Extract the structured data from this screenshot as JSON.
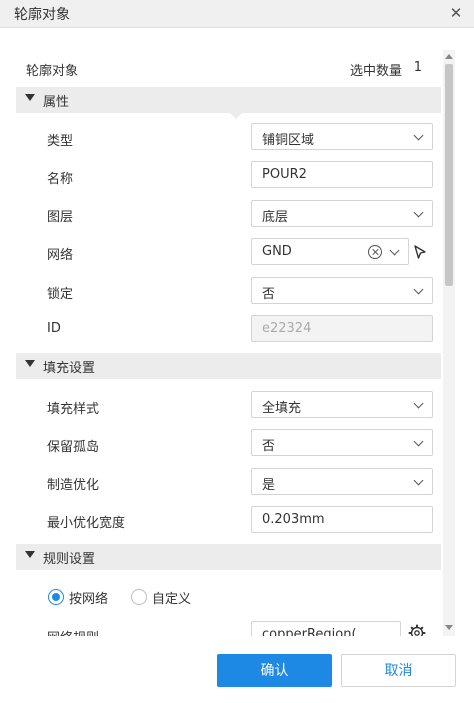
{
  "window": {
    "title": "轮廓对象"
  },
  "summary": {
    "label": "轮廓对象",
    "count_label": "选中数量",
    "count": "1"
  },
  "sections": {
    "properties": {
      "title": "属性",
      "rows": {
        "type": {
          "label": "类型",
          "value": "铺铜区域"
        },
        "name": {
          "label": "名称",
          "value": "POUR2"
        },
        "layer": {
          "label": "图层",
          "value": "底层"
        },
        "net": {
          "label": "网络",
          "value": "GND"
        },
        "lock": {
          "label": "锁定",
          "value": "否"
        },
        "id": {
          "label": "ID",
          "value": "e22324"
        }
      }
    },
    "fill": {
      "title": "填充设置",
      "rows": {
        "fill_style": {
          "label": "填充样式",
          "value": "全填充"
        },
        "keep_islands": {
          "label": "保留孤岛",
          "value": "否"
        },
        "optimize": {
          "label": "制造优化",
          "value": "是"
        },
        "min_width": {
          "label": "最小优化宽度",
          "value": "0.203mm"
        }
      }
    },
    "rules": {
      "title": "规则设置",
      "radio_by_net": "按网络",
      "radio_custom": "自定义",
      "selected": "按网络",
      "net_rule": {
        "label": "网络规则",
        "value": "copperRegion("
      }
    }
  },
  "buttons": {
    "confirm": "确认",
    "cancel": "取消"
  },
  "colors": {
    "accent": "#1e88e5",
    "section_bg": "#ececec",
    "titlebar_bg": "#f0f0f0"
  },
  "icons": [
    "close-icon",
    "caret-down-icon",
    "chevron-down-icon",
    "clear-icon",
    "pick-cursor-icon",
    "gear-icon"
  ]
}
